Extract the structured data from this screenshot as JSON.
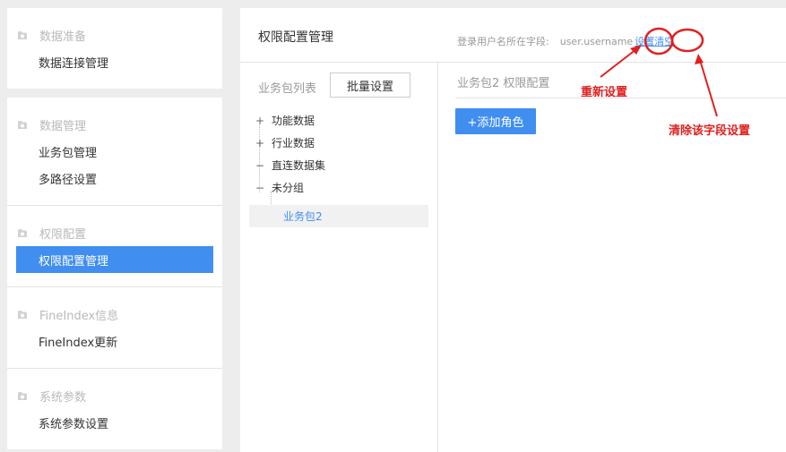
{
  "sidebar": {
    "groups": [
      {
        "title": "数据准备",
        "items": [
          "数据连接管理"
        ]
      },
      {
        "title": "数据管理",
        "items": [
          "业务包管理",
          "多路径设置"
        ]
      },
      {
        "title": "权限配置",
        "items": [
          "权限配置管理"
        ]
      },
      {
        "title": "FineIndex信息",
        "items": [
          "FineIndex更新"
        ]
      },
      {
        "title": "系统参数",
        "items": [
          "系统参数设置"
        ]
      }
    ],
    "active_item": "权限配置管理"
  },
  "main": {
    "title": "权限配置管理",
    "field_label": "登录用户名所在字段:",
    "field_value": "user.username",
    "set_link": "设置",
    "clear_link": "清空",
    "list_label": "业务包列表",
    "batch_button": "批量设置",
    "tree": [
      {
        "toggle": "+",
        "label": "功能数据"
      },
      {
        "toggle": "+",
        "label": "行业数据"
      },
      {
        "toggle": "−",
        "label": "直连数据集"
      },
      {
        "toggle": "−",
        "label": "未分组"
      },
      {
        "toggle": "",
        "label": "业务包2"
      }
    ],
    "right_title": "业务包2 权限配置",
    "add_role_button": "+添加角色"
  },
  "annotations": {
    "reset": "重新设置",
    "clear_field": "清除该字段设置",
    "color": "#e02020"
  },
  "icons": {
    "group_icon": "cloud-folder-icon"
  }
}
